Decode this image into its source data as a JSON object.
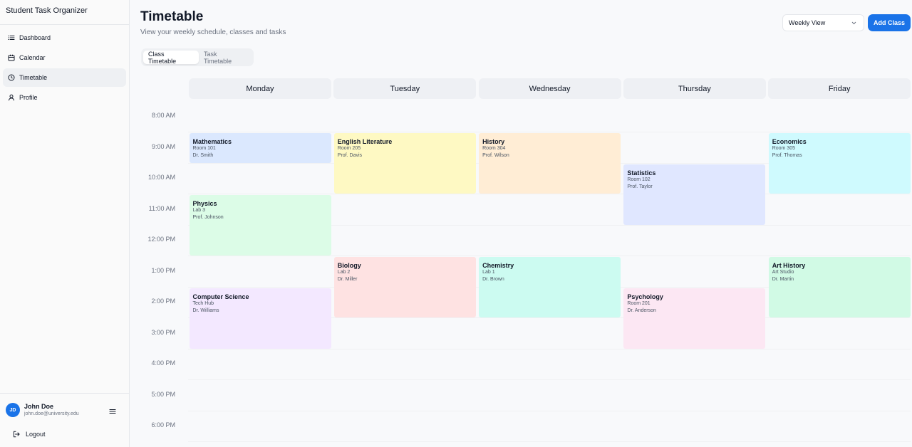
{
  "sidebar": {
    "app_title": "Student Task Organizer",
    "items": [
      {
        "label": "Dashboard",
        "icon": "list-icon"
      },
      {
        "label": "Calendar",
        "icon": "calendar-icon"
      },
      {
        "label": "Timetable",
        "icon": "clock-icon",
        "active": true
      },
      {
        "label": "Profile",
        "icon": "user-icon"
      }
    ],
    "user": {
      "initials": "JD",
      "name": "John Doe",
      "email": "john.doe@university.edu"
    },
    "logout_label": "Logout"
  },
  "header": {
    "title": "Timetable",
    "subtitle": "View your weekly schedule, classes and tasks",
    "view_select": "Weekly View",
    "add_button": "Add Class"
  },
  "tabs": [
    {
      "label": "Class Timetable",
      "active": true
    },
    {
      "label": "Task Timetable",
      "active": false
    }
  ],
  "days": [
    "Monday",
    "Tuesday",
    "Wednesday",
    "Thursday",
    "Friday"
  ],
  "times": [
    "8:00 AM",
    "9:00 AM",
    "10:00 AM",
    "11:00 AM",
    "12:00 PM",
    "1:00 PM",
    "2:00 PM",
    "3:00 PM",
    "4:00 PM",
    "5:00 PM",
    "6:00 PM"
  ],
  "events": [
    {
      "title": "Mathematics",
      "room": "Room 101",
      "teacher": "Dr. Smith",
      "day": 0,
      "start": "9:00 AM",
      "end": "10:00 AM",
      "color": "#dbe8fe"
    },
    {
      "title": "Physics",
      "room": "Lab 3",
      "teacher": "Prof. Johnson",
      "day": 0,
      "start": "11:00 AM",
      "end": "1:00 PM",
      "color": "#dcfce7"
    },
    {
      "title": "Computer Science",
      "room": "Tech Hub",
      "teacher": "Dr. Williams",
      "day": 0,
      "start": "2:00 PM",
      "end": "4:00 PM",
      "color": "#f3e8ff"
    },
    {
      "title": "English Literature",
      "room": "Room 205",
      "teacher": "Prof. Davis",
      "day": 1,
      "start": "9:00 AM",
      "end": "11:00 AM",
      "color": "#fef9c3"
    },
    {
      "title": "Biology",
      "room": "Lab 2",
      "teacher": "Dr. Miller",
      "day": 1,
      "start": "1:00 PM",
      "end": "3:00 PM",
      "color": "#fee2e2"
    },
    {
      "title": "History",
      "room": "Room 304",
      "teacher": "Prof. Wilson",
      "day": 2,
      "start": "9:00 AM",
      "end": "11:00 AM",
      "color": "#ffedd5"
    },
    {
      "title": "Chemistry",
      "room": "Lab 1",
      "teacher": "Dr. Brown",
      "day": 2,
      "start": "1:00 PM",
      "end": "3:00 PM",
      "color": "#ccfbf1"
    },
    {
      "title": "Statistics",
      "room": "Room 102",
      "teacher": "Prof. Taylor",
      "day": 3,
      "start": "10:00 AM",
      "end": "12:00 PM",
      "color": "#e0e7ff"
    },
    {
      "title": "Psychology",
      "room": "Room 201",
      "teacher": "Dr. Anderson",
      "day": 3,
      "start": "2:00 PM",
      "end": "4:00 PM",
      "color": "#fce7f3"
    },
    {
      "title": "Economics",
      "room": "Room 305",
      "teacher": "Prof. Thomas",
      "day": 4,
      "start": "9:00 AM",
      "end": "11:00 AM",
      "color": "#cffafe"
    },
    {
      "title": "Art History",
      "room": "Art Studio",
      "teacher": "Dr. Martin",
      "day": 4,
      "start": "1:00 PM",
      "end": "3:00 PM",
      "color": "#d1fae5"
    }
  ]
}
